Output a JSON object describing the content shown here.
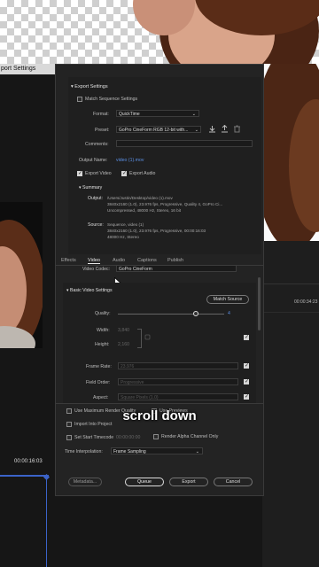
{
  "window": {
    "title": "port Settings"
  },
  "export_settings": {
    "heading": "Export Settings",
    "match_sequence": "Match Sequence Settings",
    "format_label": "Format:",
    "format_value": "QuickTime",
    "preset_label": "Preset:",
    "preset_value": "GoPro CineForm RGB 12-bit with...",
    "comments_label": "Comments:",
    "output_name_label": "Output Name:",
    "output_name_value": "video (1).mov",
    "export_video": "Export Video",
    "export_audio": "Export Audio"
  },
  "summary": {
    "heading": "Summary",
    "output_label": "Output:",
    "output_lines": [
      "/Users/Justin/Desktop/video (1).mov",
      "3840x2160 (1.0), 23.976 fps, Progressive, Quality 4, GoPro Ci...",
      "Uncompressed, 48000 Hz, Stereo, 16 bit"
    ],
    "source_label": "Source:",
    "source_lines": [
      "Sequence, video (1)",
      "3840x2160 (1.0), 23.976 fps, Progressive, 00:00:16:03",
      "48000 Hz, Stereo"
    ]
  },
  "tabs": [
    "Effects",
    "Video",
    "Audio",
    "Captions",
    "Publish"
  ],
  "active_tab": "Video",
  "video": {
    "codec_label": "Video Codec:",
    "codec_value": "GoPro CineForm",
    "basic_heading": "Basic Video Settings",
    "match_source": "Match Source",
    "quality_label": "Quality:",
    "quality_value": "4",
    "width_label": "Width:",
    "width_value": "3,840",
    "height_label": "Height:",
    "height_value": "2,160",
    "frame_rate_label": "Frame Rate:",
    "frame_rate_value": "23.976",
    "field_order_label": "Field Order:",
    "field_order_value": "Progressive",
    "aspect_label": "Aspect:",
    "aspect_value": "Square Pixels (1.0)"
  },
  "bottom": {
    "max_render": "Use Maximum Render Quality",
    "use_previews": "Use Previews",
    "import_project": "Import Into Project",
    "set_start_tc": "Set Start Timecode",
    "start_tc_value": "00:00:00:00",
    "render_alpha": "Render Alpha Channel Only",
    "time_interp_label": "Time Interpolation:",
    "time_interp_value": "Frame Sampling"
  },
  "buttons": {
    "metadata": "Metadata...",
    "queue": "Queue",
    "export": "Export",
    "cancel": "Cancel"
  },
  "left_timecode": "00:00:16:03",
  "right_timecode": "00:00:34:23",
  "caption": "scroll down",
  "colors": {
    "accent": "#5b8fe3",
    "timeline_blue": "#3b63c9"
  }
}
